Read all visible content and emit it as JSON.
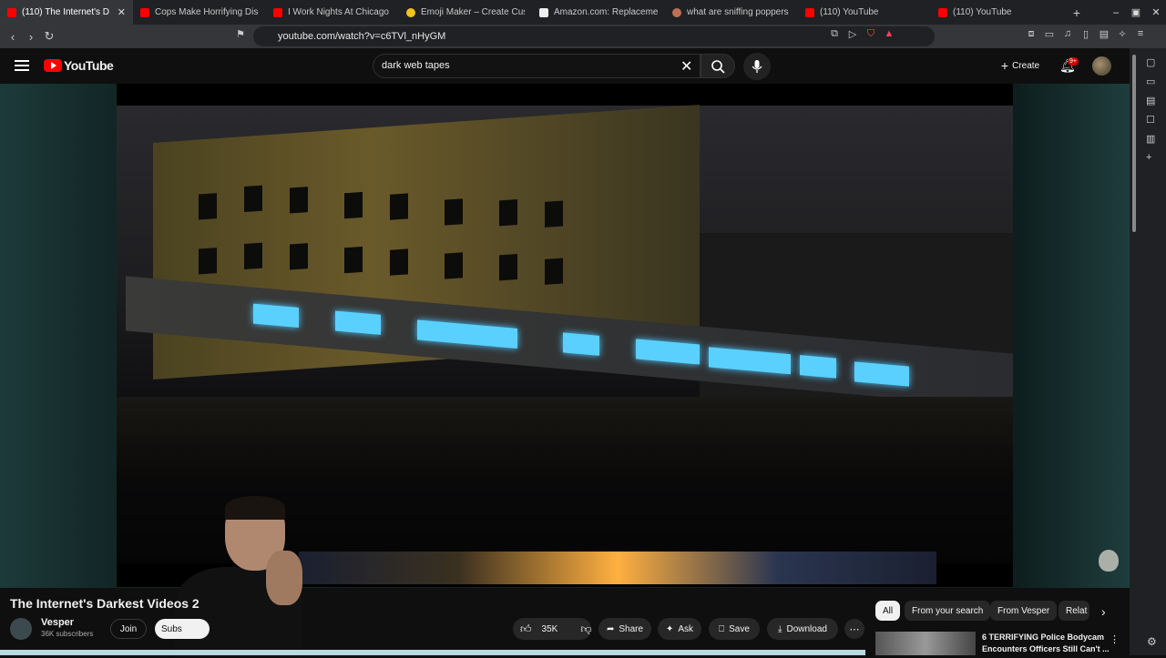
{
  "browser": {
    "tabs": [
      {
        "title": "(110) The Internet's D",
        "active": true,
        "favicon": "youtube-red"
      },
      {
        "title": "Cops Make Horrifying Disco",
        "active": false,
        "favicon": "youtube-red"
      },
      {
        "title": "I Work Nights At Chicago Ur",
        "active": false,
        "favicon": "youtube-red"
      },
      {
        "title": "Emoji Maker – Create Custo",
        "active": false,
        "favicon": "emoji"
      },
      {
        "title": "Amazon.com: Replacement",
        "active": false,
        "favicon": "amazon"
      },
      {
        "title": "what are sniffing poppers",
        "active": false,
        "favicon": "search"
      },
      {
        "title": "(110) YouTube",
        "active": false,
        "favicon": "youtube-red"
      },
      {
        "title": "(110) YouTube",
        "active": false,
        "favicon": "youtube-red"
      }
    ],
    "url": "youtube.com/watch?v=c6TVl_nHyGM"
  },
  "youtube": {
    "logo_text": "YouTube",
    "search_value": "dark web tapes",
    "create_label": "Create",
    "notif_badge": "9+"
  },
  "video": {
    "title": "The Internet's Darkest Videos 2",
    "channel": "Vesper",
    "subscribers": "36K subscribers",
    "join_label": "Join",
    "subscribe_label": "Subs",
    "likes": "35K",
    "share_label": "Share",
    "ask_label": "Ask",
    "save_label": "Save",
    "download_label": "Download"
  },
  "chips": [
    "All",
    "From your search",
    "From Vesper",
    "Relat"
  ],
  "recommendation": {
    "title": "6 TERRIFYING Police Bodycam Encounters Officers Still Can't ..."
  },
  "colors": {
    "brand": "#ff0000",
    "bg": "#0f0f0f",
    "accent_blue": "#5ad0ff"
  }
}
